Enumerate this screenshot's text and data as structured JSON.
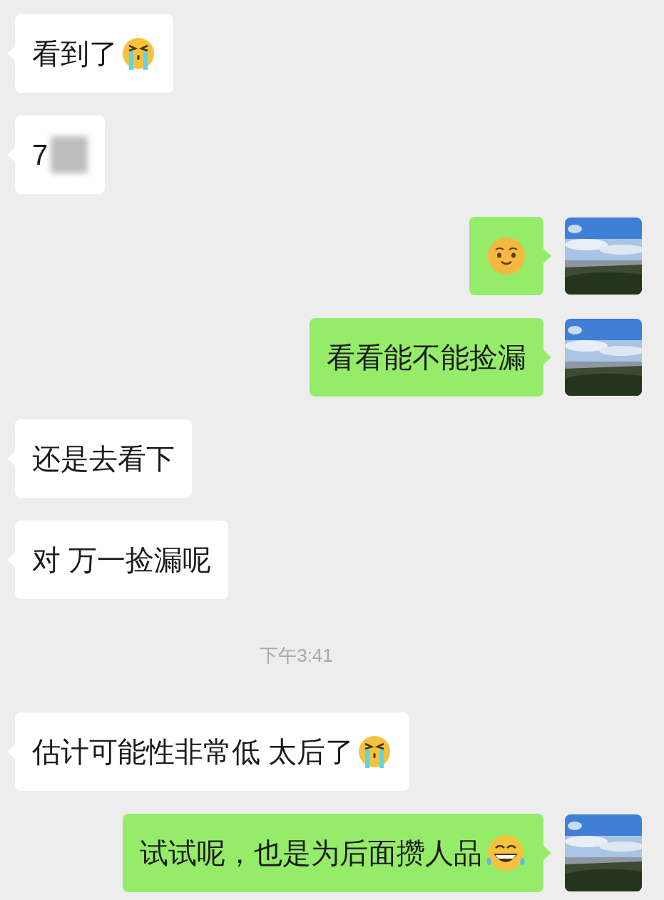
{
  "messages": [
    {
      "kind": "incoming",
      "text": "看到了",
      "emoji": {
        "kind": "crying"
      }
    },
    {
      "kind": "incoming",
      "text": "7",
      "redacted": true
    },
    {
      "kind": "outgoing",
      "emoji": {
        "kind": "shy"
      }
    },
    {
      "kind": "outgoing",
      "text": "看看能不能捡漏"
    },
    {
      "kind": "incoming",
      "text": "还是去看下"
    },
    {
      "kind": "incoming",
      "text": "对 万一捡漏呢"
    },
    {
      "kind": "time",
      "text": "下午3:41"
    },
    {
      "kind": "incoming",
      "text": "估计可能性非常低 太后了",
      "emoji": {
        "kind": "crying"
      }
    },
    {
      "kind": "outgoing",
      "text": "试试呢，也是为后面攒人品",
      "emoji": {
        "kind": "laughing"
      }
    }
  ]
}
